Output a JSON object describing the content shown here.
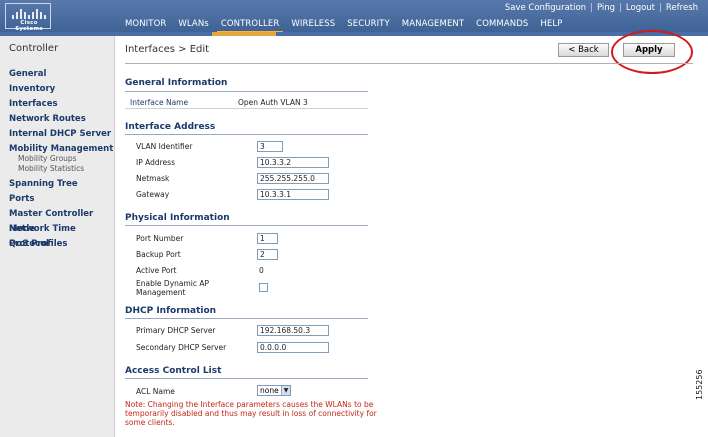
{
  "header": {
    "logo_text": "Cisco Systems",
    "top_links": [
      "Save Configuration",
      "Ping",
      "Logout",
      "Refresh"
    ],
    "nav": [
      "MONITOR",
      "WLANs",
      "CONTROLLER",
      "WIRELESS",
      "SECURITY",
      "MANAGEMENT",
      "COMMANDS",
      "HELP"
    ],
    "active_nav": "CONTROLLER"
  },
  "sidebar": {
    "title": "Controller",
    "items": [
      {
        "label": "General"
      },
      {
        "label": "Inventory"
      },
      {
        "label": "Interfaces"
      },
      {
        "label": "Network Routes"
      },
      {
        "label": "Internal DHCP Server"
      },
      {
        "label": "Mobility Management"
      },
      {
        "label": "Spanning Tree"
      },
      {
        "label": "Ports"
      },
      {
        "label": "Master Controller Mode"
      },
      {
        "label": "Network Time Protocol"
      },
      {
        "label": "QoS Profiles"
      }
    ],
    "sub_items": [
      "Mobility Groups",
      "Mobility Statistics"
    ]
  },
  "page": {
    "title": "Interfaces > Edit",
    "back_label": "< Back",
    "apply_label": "Apply"
  },
  "general": {
    "title": "General Information",
    "interface_name_label": "Interface Name",
    "interface_name_value": "Open Auth VLAN 3"
  },
  "address": {
    "title": "Interface Address",
    "vlan_label": "VLAN Identifier",
    "vlan_value": "3",
    "ip_label": "IP Address",
    "ip_value": "10.3.3.2",
    "netmask_label": "Netmask",
    "netmask_value": "255.255.255.0",
    "gateway_label": "Gateway",
    "gateway_value": "10.3.3.1"
  },
  "physical": {
    "title": "Physical Information",
    "port_label": "Port Number",
    "port_value": "1",
    "backup_label": "Backup Port",
    "backup_value": "2",
    "active_label": "Active Port",
    "active_value": "0",
    "dynamic_ap_label_line1": "Enable Dynamic AP",
    "dynamic_ap_label_line2": "Management",
    "dynamic_ap_checked": false
  },
  "dhcp": {
    "title": "DHCP Information",
    "primary_label": "Primary DHCP Server",
    "primary_value": "192.168.50.3",
    "secondary_label": "Secondary DHCP Server",
    "secondary_value": "0.0.0.0"
  },
  "acl": {
    "title": "Access Control List",
    "name_label": "ACL Name",
    "name_value": "none"
  },
  "note": "Note: Changing the Interface parameters causes the WLANs to be temporarily disabled and thus may result in loss of connectivity for some clients.",
  "figure_id": "155256",
  "colors": {
    "header_blue": "#4a6fa5",
    "nav_accent": "#e6a73a",
    "section_title": "#1b3a6b",
    "note_red": "#c0281a",
    "highlight_red": "#d21a1a"
  }
}
